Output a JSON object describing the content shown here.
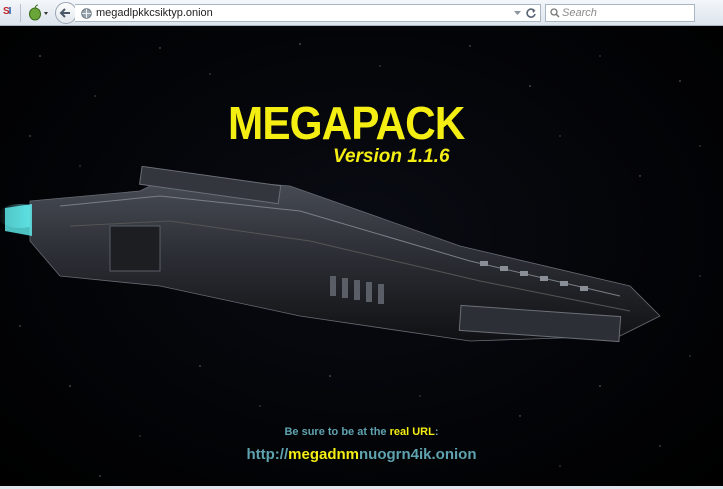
{
  "browser": {
    "url": "megadlpkkcsiktyp.onion",
    "search_placeholder": "Search"
  },
  "page": {
    "title": "MEGAPACK",
    "version": "Version 1.1.6",
    "notice_prefix": "Be sure to be at the ",
    "notice_highlight": "real URL",
    "notice_suffix": ":",
    "real_url_prefix": "http://",
    "real_url_highlight": "megadnm",
    "real_url_suffix": "nuogrn4ik.onion"
  },
  "colors": {
    "accent_yellow": "#f4ee13",
    "accent_teal": "#5fa3b0",
    "background": "#000000"
  },
  "icons": [
    "si-logo-icon",
    "onion-icon",
    "back-arrow-icon",
    "globe-icon",
    "dropdown-icon",
    "reload-icon",
    "search-icon"
  ]
}
